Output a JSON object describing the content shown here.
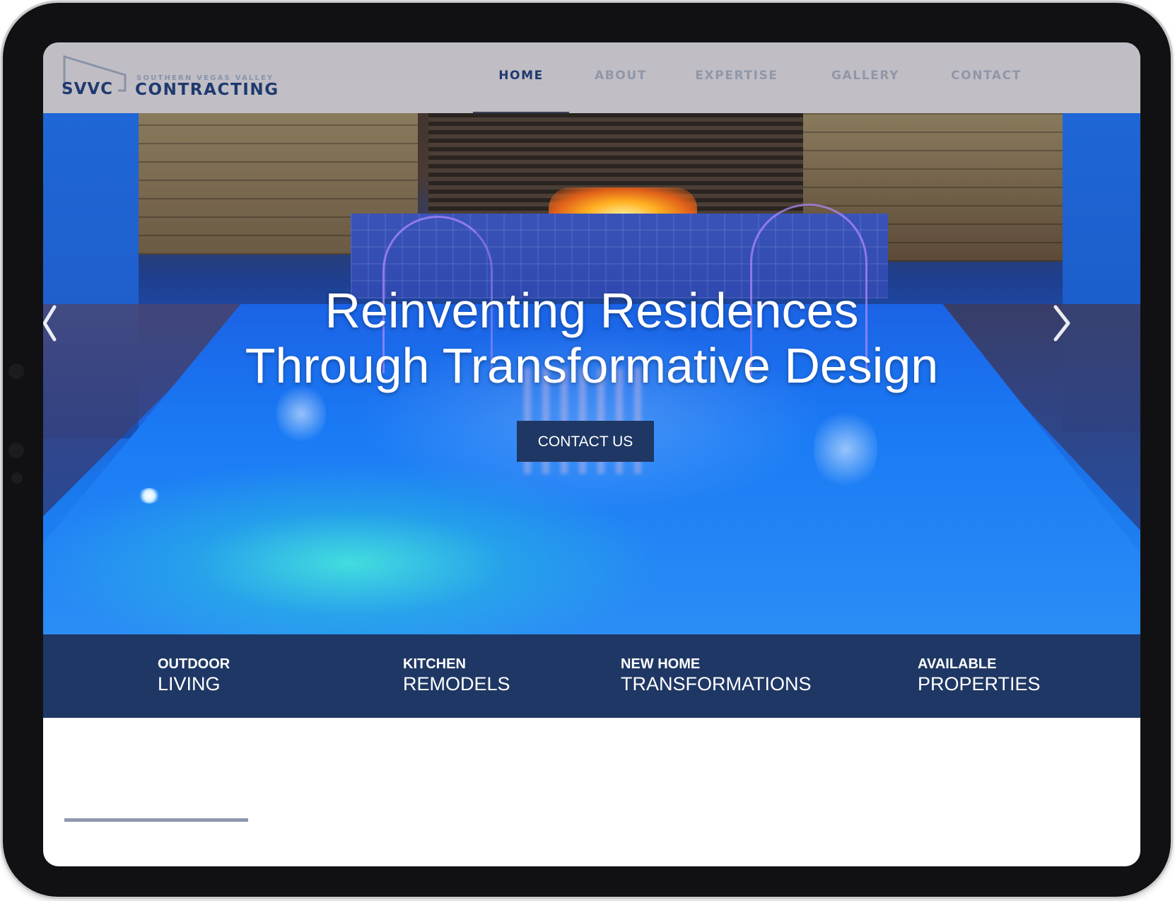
{
  "header": {
    "logo": {
      "mark": "SVVC",
      "tagline": "SOUTHERN VEGAS VALLEY",
      "wordmark": "CONTRACTING"
    },
    "nav": [
      {
        "label": "HOME",
        "active": true
      },
      {
        "label": "ABOUT",
        "active": false
      },
      {
        "label": "EXPERTISE",
        "active": false
      },
      {
        "label": "GALLERY",
        "active": false
      },
      {
        "label": "CONTACT",
        "active": false
      }
    ]
  },
  "hero": {
    "title_line1": "Reinventing Residences",
    "title_line2": "Through Transformative Design",
    "cta_label": "CONTACT US",
    "prev_icon": "chevron-left-icon",
    "next_icon": "chevron-right-icon"
  },
  "services": [
    {
      "kicker": "OUTDOOR",
      "label": "LIVING"
    },
    {
      "kicker": "KITCHEN",
      "label": "REMODELS"
    },
    {
      "kicker": "NEW HOME",
      "label": "TRANSFORMATIONS"
    },
    {
      "kicker": "AVAILABLE",
      "label": "PROPERTIES"
    }
  ],
  "colors": {
    "navy": "#1f3764",
    "brand_text": "#1e3a6e",
    "nav_inactive": "#8f97a8",
    "divider": "#8f98ad"
  }
}
